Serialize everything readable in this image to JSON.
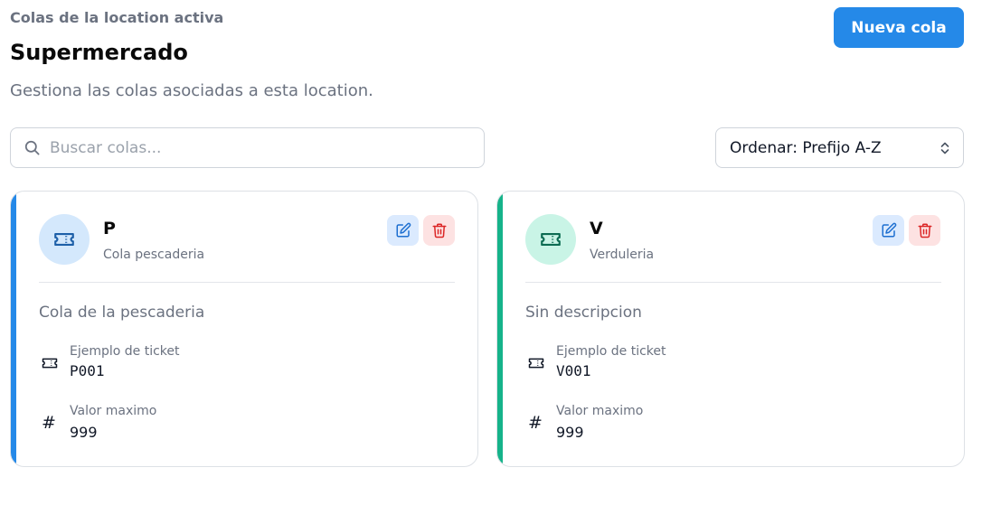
{
  "header": {
    "eyebrow": "Colas de la location activa",
    "title": "Supermercado",
    "subtitle": "Gestiona las colas asociadas a esta location.",
    "new_button": "Nueva cola"
  },
  "search": {
    "placeholder": "Buscar colas...",
    "value": ""
  },
  "sort": {
    "label": "Ordenar: Prefijo A-Z"
  },
  "labels": {
    "ticket_example": "Ejemplo de ticket",
    "max_value": "Valor maximo"
  },
  "queues": [
    {
      "prefix": "P",
      "name": "Cola pescaderia",
      "description": "Cola de la pescaderia",
      "ticket_example": "P001",
      "max_value": "999",
      "accent": "#2589e8",
      "avatar_bg": "#d4e8fc",
      "icon_color": "#1d5fa8"
    },
    {
      "prefix": "V",
      "name": "Verduleria",
      "description": "Sin descripcion",
      "ticket_example": "V001",
      "max_value": "999",
      "accent": "#16b38a",
      "avatar_bg": "#c9f4e6",
      "icon_color": "#0c6b52"
    }
  ],
  "icons": {
    "search": "search-icon",
    "sort": "chevron-up-down-icon",
    "edit": "edit-icon",
    "delete": "trash-icon",
    "ticket": "ticket-icon",
    "max": "hash-icon"
  },
  "colors": {
    "primary": "#2589e8",
    "edit_bg": "#dbeafe",
    "delete_bg": "#fde2e2",
    "delete_fg": "#dc2626"
  }
}
